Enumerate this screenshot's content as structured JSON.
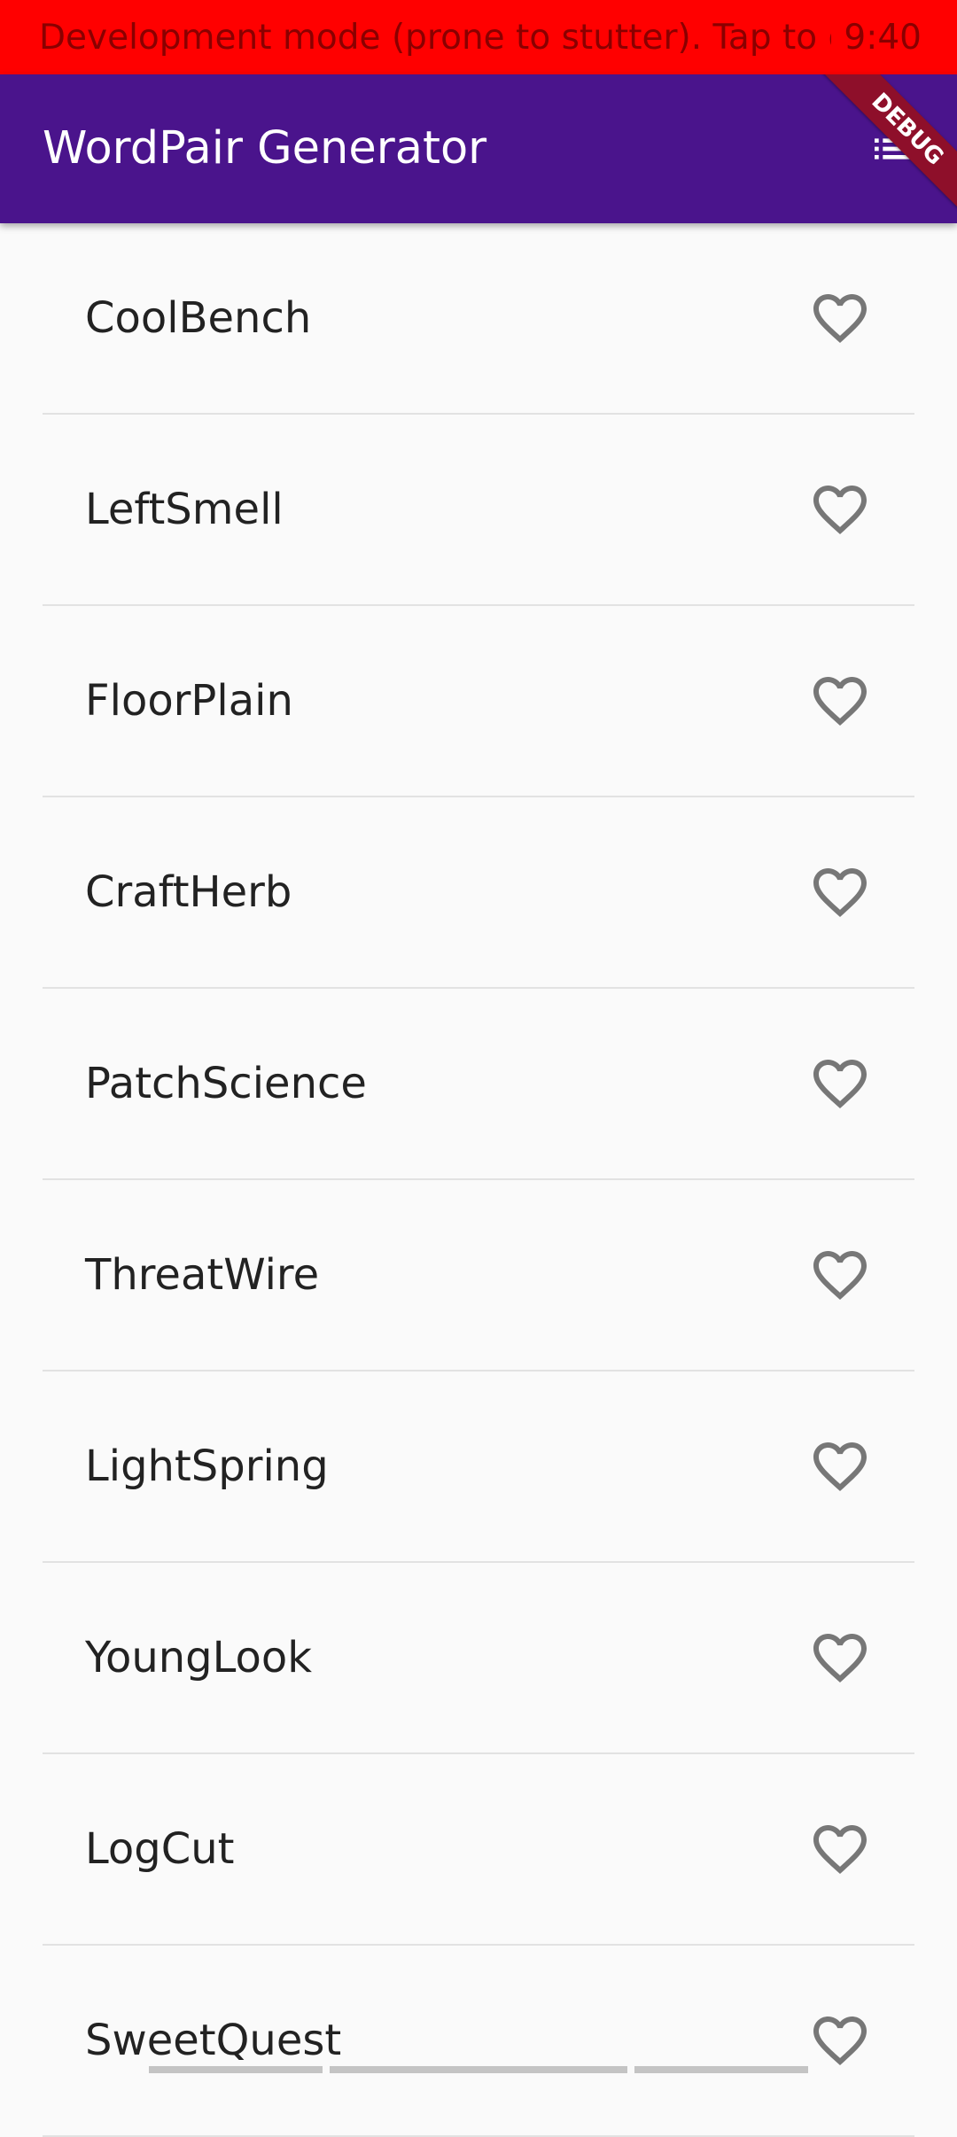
{
  "status_bar": {
    "message": "Development mode (prone to stutter). Tap to di…",
    "time": "9:40",
    "background": "#ff0000"
  },
  "app_bar": {
    "title": "WordPair Generator",
    "action_icon": "list-icon",
    "banner_text": "DEBUG",
    "background": "#4a148c"
  },
  "word_pairs": [
    {
      "label": "CoolBench",
      "favorite": false,
      "icon": "heart-outline-icon"
    },
    {
      "label": "LeftSmell",
      "favorite": false,
      "icon": "heart-outline-icon"
    },
    {
      "label": "FloorPlain",
      "favorite": false,
      "icon": "heart-outline-icon"
    },
    {
      "label": "CraftHerb",
      "favorite": false,
      "icon": "heart-outline-icon"
    },
    {
      "label": "PatchScience",
      "favorite": false,
      "icon": "heart-outline-icon"
    },
    {
      "label": "ThreatWire",
      "favorite": false,
      "icon": "heart-outline-icon"
    },
    {
      "label": "LightSpring",
      "favorite": false,
      "icon": "heart-outline-icon"
    },
    {
      "label": "YoungLook",
      "favorite": false,
      "icon": "heart-outline-icon"
    },
    {
      "label": "LogCut",
      "favorite": false,
      "icon": "heart-outline-icon"
    },
    {
      "label": "SweetQuest",
      "favorite": false,
      "icon": "heart-outline-icon"
    }
  ]
}
